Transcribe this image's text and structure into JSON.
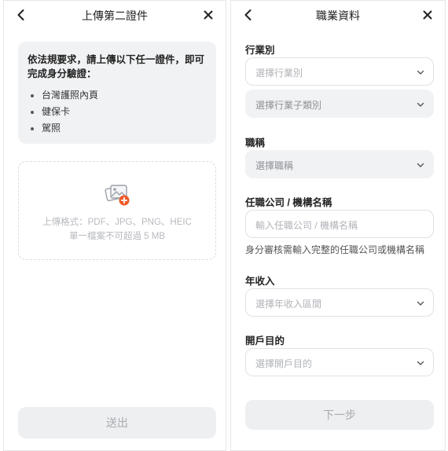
{
  "left": {
    "title": "上傳第二證件",
    "notice_title": "依法規要求，請上傳以下任一證件，即可完成身分驗證：",
    "doc_options": [
      "台灣護照內頁",
      "健保卡",
      "駕照"
    ],
    "upload_format": "上傳格式：PDF、JPG、PNG、HEIC",
    "upload_limit": "單一檔案不可超過 5 MB",
    "submit_label": "送出"
  },
  "right": {
    "title": "職業資料",
    "industry_label": "行業別",
    "industry_placeholder": "選擇行業別",
    "industry_sub_placeholder": "選擇行業子類別",
    "job_title_label": "職稱",
    "job_title_placeholder": "選擇職稱",
    "company_label": "任職公司 / 機構名稱",
    "company_placeholder": "輸入任職公司 / 機構名稱",
    "company_helper": "身分審核需輸入完整的任職公司或機構名稱",
    "income_label": "年收入",
    "income_placeholder": "選擇年收入區間",
    "purpose_label": "開戶目的",
    "purpose_placeholder": "選擇開戶目的",
    "next_label": "下一步"
  },
  "icons": {
    "back": "chevron-left-icon",
    "close": "close-icon",
    "dropdown": "chevron-down-icon",
    "upload": "image-add-icon"
  },
  "colors": {
    "upload_badge": "#f05a28",
    "card_bg": "#f1f2f4",
    "placeholder": "#b1b3b8"
  }
}
